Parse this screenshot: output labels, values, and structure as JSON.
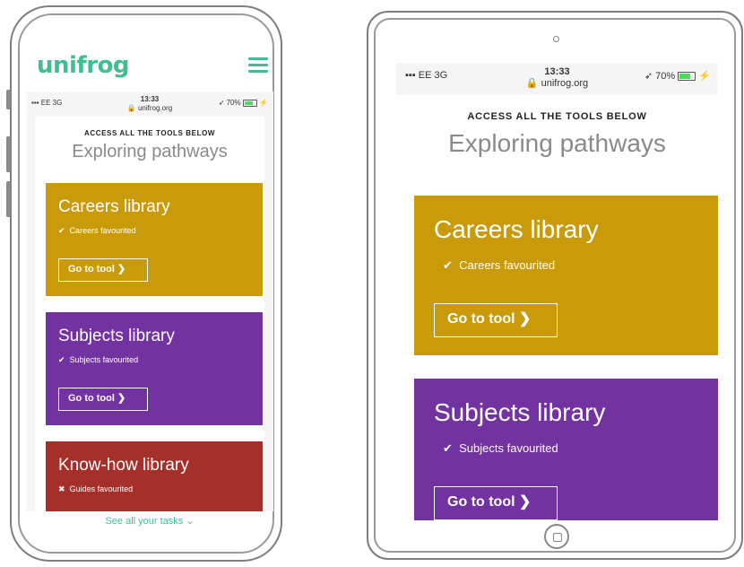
{
  "phone": {
    "logo": "unifrog",
    "status": {
      "carrier": "EE  3G",
      "time": "13:33",
      "url": "unifrog.org",
      "battery": "70%"
    },
    "eyebrow": "ACCESS ALL THE TOOLS BELOW",
    "heading": "Exploring pathways",
    "cards": [
      {
        "title": "Careers library",
        "favourite": "Careers favourited",
        "mark": "✔",
        "button": "Go to tool"
      },
      {
        "title": "Subjects library",
        "favourite": "Subjects favourited",
        "mark": "✔",
        "button": "Go to tool"
      },
      {
        "title": "Know-how library",
        "favourite": "Guides favourited",
        "mark": "✖"
      }
    ],
    "footer_link": "See all your tasks ⌄"
  },
  "tablet": {
    "status": {
      "carrier": "EE  3G",
      "time": "13:33",
      "url": "unifrog.org",
      "battery": "70%"
    },
    "eyebrow": "ACCESS ALL THE TOOLS BELOW",
    "heading": "Exploring pathways",
    "cards": [
      {
        "title": "Careers library",
        "favourite": "Careers favourited",
        "mark": "✔",
        "button": "Go to tool"
      },
      {
        "title": "Subjects library",
        "favourite": "Subjects favourited",
        "mark": "✔",
        "button": "Go to tool"
      }
    ]
  },
  "colors": {
    "brand": "#3fbf8f",
    "careers": "#c99a0a",
    "subjects": "#7232a0",
    "knowhow": "#a5302a"
  }
}
